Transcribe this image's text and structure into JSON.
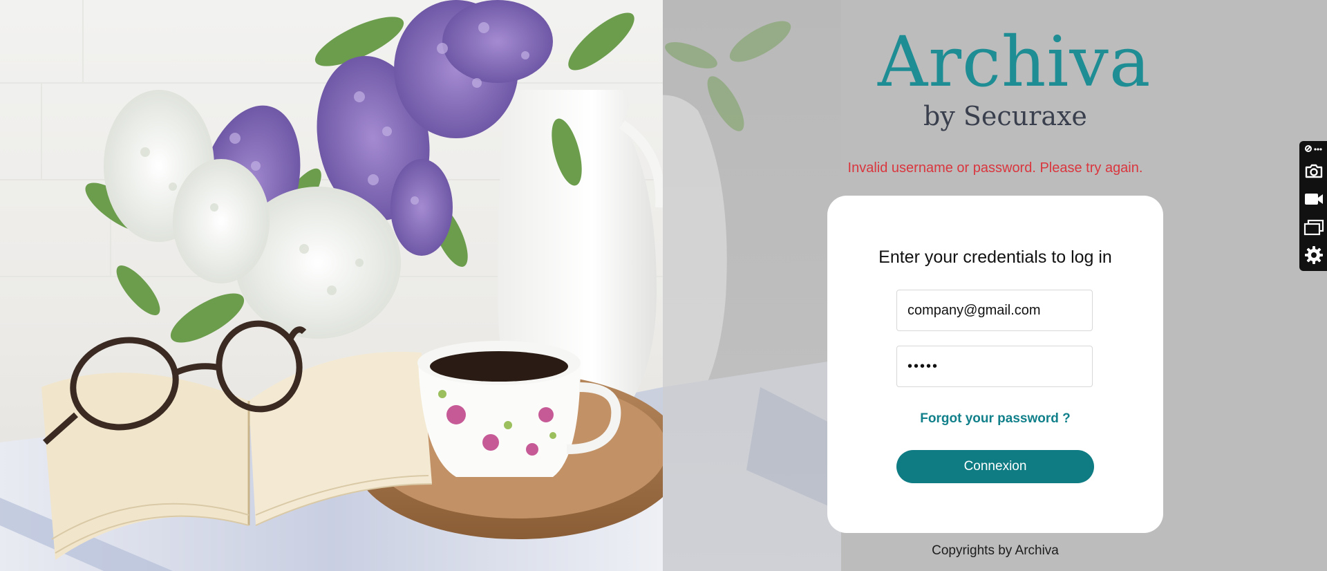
{
  "logo": {
    "brand": "Archiva",
    "tagline": "by Securaxe",
    "color": "#1f8d94"
  },
  "error": {
    "message": "Invalid username or password. Please try again.",
    "color": "#d9363e"
  },
  "login": {
    "title": "Enter your credentials to log in",
    "email_value": "company@gmail.com",
    "password_value": "•••••",
    "forgot_label": "Forgot your password ?",
    "submit_label": "Connexion",
    "accent": "#0f7c84"
  },
  "footer": {
    "copyright": "Copyrights by Archiva"
  },
  "toolbar": {
    "items": [
      "more-icon",
      "camera-icon",
      "video-icon",
      "windows-icon",
      "gear-icon"
    ]
  },
  "background": {
    "description_icons": [
      "lilac-flowers",
      "white-vase",
      "open-book",
      "glasses",
      "tea-cup",
      "wooden-tray"
    ]
  }
}
